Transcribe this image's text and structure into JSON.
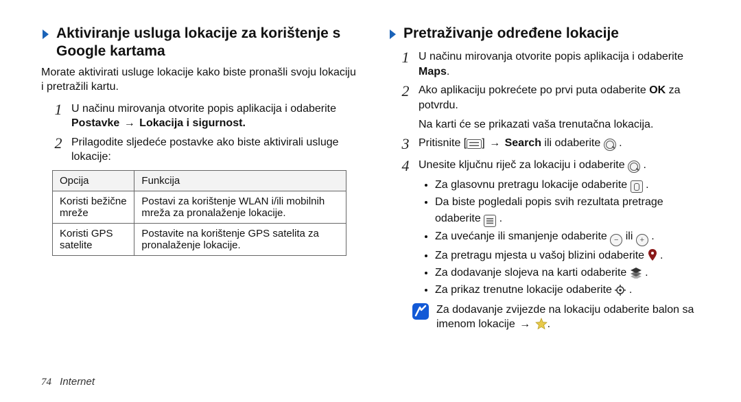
{
  "left": {
    "heading": "Aktiviranje usluga lokacije za korištenje s Google kartama",
    "intro": "Morate aktivirati usluge lokacije kako biste pronašli svoju lokaciju i pretražili kartu.",
    "step1_a": "U načinu mirovanja otvorite popis aplikacija i odaberite ",
    "step1_b": "Postavke",
    "step1_c": "Lokacija i sigurnost",
    "step2": "Prilagodite sljedeće postavke ako biste aktivirali usluge lokacije:",
    "table": {
      "h1": "Opcija",
      "h2": "Funkcija",
      "rows": [
        {
          "c1": "Koristi bežične mreže",
          "c2": "Postavi za korištenje WLAN i/ili mobilnih mreža za pronalaženje lokacije."
        },
        {
          "c1": "Koristi GPS satelite",
          "c2": "Postavite na korištenje GPS satelita za pronalaženje lokacije."
        }
      ]
    }
  },
  "right": {
    "heading": "Pretraživanje određene lokacije",
    "step1_a": "U načinu mirovanja otvorite popis aplikacija i odaberite ",
    "step1_b": "Maps",
    "step2_a": "Ako aplikaciju pokrećete po prvi puta odaberite ",
    "step2_b": "OK",
    "step2_c": " za potvrdu.",
    "step2_after": "Na karti će se prikazati vaša trenutačna lokacija.",
    "step3_a": "Pritisnite [",
    "step3_b": "] ",
    "step3_c": "Search",
    "step3_d": " ili odaberite ",
    "step4": "Unesite ključnu riječ za lokaciju i odaberite ",
    "bullets": {
      "b1": "Za glasovnu pretragu lokacije odaberite ",
      "b2": "Da biste pogledali popis svih rezultata pretrage odaberite ",
      "b3a": "Za uvećanje ili smanjenje odaberite ",
      "b3b": " ili ",
      "b4": "Za pretragu mjesta u vašoj blizini odaberite ",
      "b5": "Za dodavanje slojeva na karti odaberite ",
      "b6": "Za prikaz trenutne lokacije odaberite "
    },
    "note_a": "Za dodavanje zvijezde na lokaciju odaberite balon sa imenom lokacije ",
    "note_b": "."
  },
  "footer": {
    "page": "74",
    "section": "Internet"
  },
  "arrow": "→"
}
